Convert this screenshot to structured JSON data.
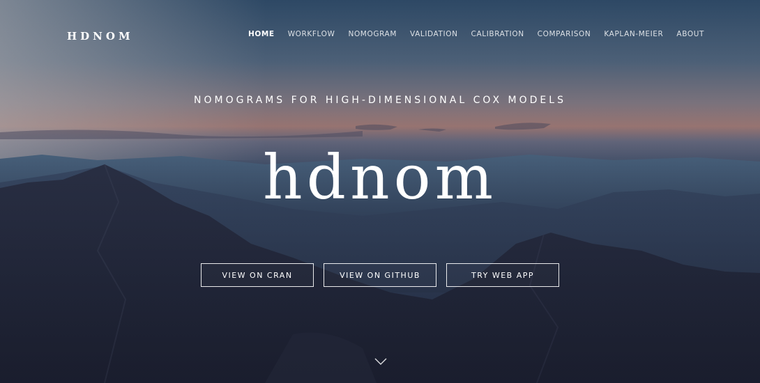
{
  "brand": {
    "name": "HDNOM"
  },
  "nav": {
    "items": [
      {
        "label": "HOME",
        "active": true
      },
      {
        "label": "WORKFLOW",
        "active": false
      },
      {
        "label": "NOMOGRAM",
        "active": false
      },
      {
        "label": "VALIDATION",
        "active": false
      },
      {
        "label": "CALIBRATION",
        "active": false
      },
      {
        "label": "COMPARISON",
        "active": false
      },
      {
        "label": "KAPLAN-MEIER",
        "active": false
      },
      {
        "label": "ABOUT",
        "active": false
      }
    ]
  },
  "hero": {
    "tagline": "NOMOGRAMS FOR HIGH-DIMENSIONAL COX MODELS",
    "title": "hdnom",
    "buttons": [
      {
        "label": "VIEW ON CRAN"
      },
      {
        "label": "VIEW ON GITHUB"
      },
      {
        "label": "TRY WEB APP"
      }
    ],
    "scroll_icon": "chevron-down-icon"
  },
  "colors": {
    "text": "#ffffff",
    "sky_top": "#2e4a66",
    "horizon_glow": "#a77f7b",
    "mountain_dark": "#1c2133"
  }
}
